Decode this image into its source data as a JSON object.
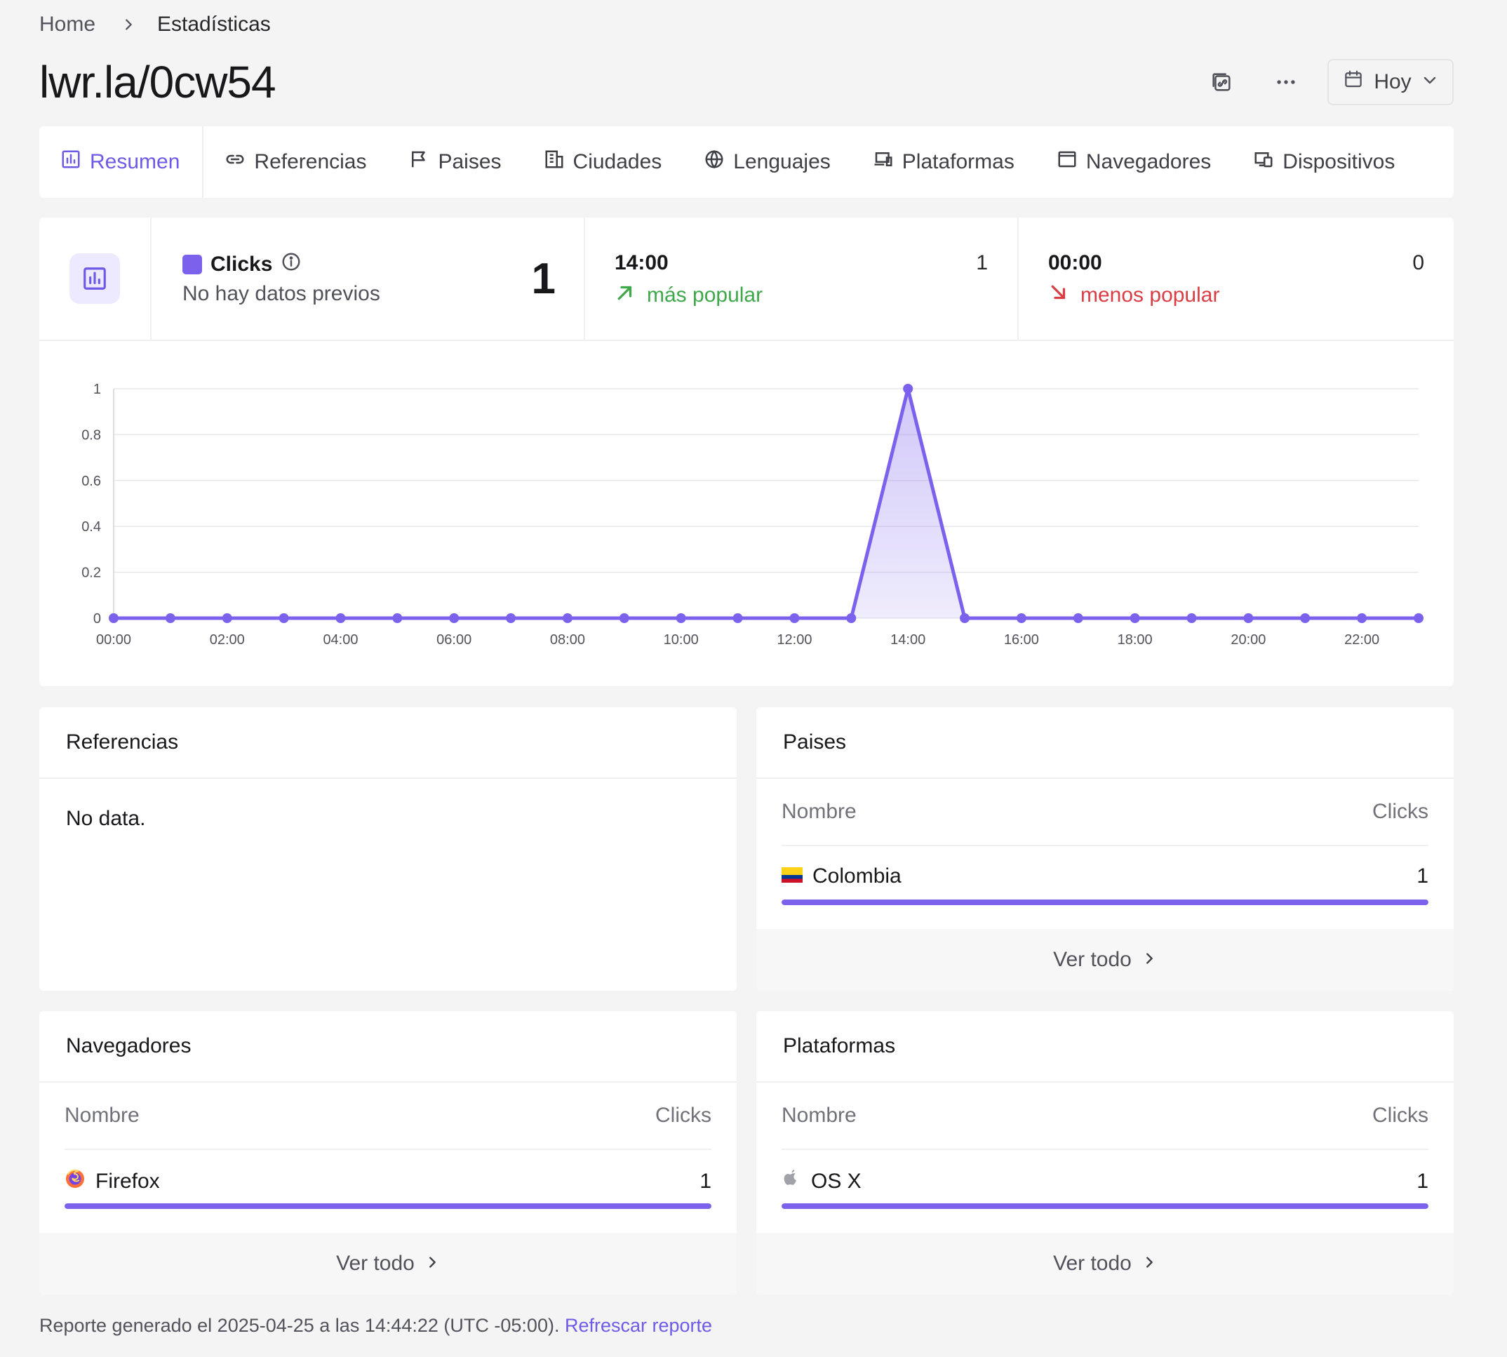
{
  "breadcrumb": {
    "home": "Home",
    "current": "Estadísticas"
  },
  "page_title": "lwr.la/0cw54",
  "top_actions": {
    "icons": [
      "copy-link-icon",
      "more-icon"
    ],
    "date_label": "Hoy"
  },
  "tabs": [
    {
      "label": "Resumen",
      "icon": "bar-chart-icon",
      "active": true
    },
    {
      "label": "Referencias",
      "icon": "link-icon"
    },
    {
      "label": "Paises",
      "icon": "flag-icon"
    },
    {
      "label": "Ciudades",
      "icon": "building-icon"
    },
    {
      "label": "Lenguajes",
      "icon": "globe-icon"
    },
    {
      "label": "Plataformas",
      "icon": "devices-icon"
    },
    {
      "label": "Navegadores",
      "icon": "browser-window-icon"
    },
    {
      "label": "Dispositivos",
      "icon": "device-icon"
    }
  ],
  "stats": {
    "clicks_label": "Clicks",
    "clicks_subtext": "No hay datos previos",
    "clicks_total": "1",
    "peak_hour": "14:00",
    "peak_count": "1",
    "peak_label": "más popular",
    "low_hour": "00:00",
    "low_count": "0",
    "low_label": "menos popular"
  },
  "colors": {
    "accent": "#7b61ec",
    "up": "#3ea84a",
    "down": "#d93e45"
  },
  "chart_data": {
    "type": "area",
    "x": [
      "00:00",
      "01:00",
      "02:00",
      "03:00",
      "04:00",
      "05:00",
      "06:00",
      "07:00",
      "08:00",
      "09:00",
      "10:00",
      "11:00",
      "12:00",
      "13:00",
      "14:00",
      "15:00",
      "16:00",
      "17:00",
      "18:00",
      "19:00",
      "20:00",
      "21:00",
      "22:00",
      "23:00"
    ],
    "series": [
      {
        "values": [
          0,
          0,
          0,
          0,
          0,
          0,
          0,
          0,
          0,
          0,
          0,
          0,
          0,
          0,
          1,
          0,
          0,
          0,
          0,
          0,
          0,
          0,
          0,
          0
        ]
      }
    ],
    "xtick_labels": [
      "00:00",
      "02:00",
      "04:00",
      "06:00",
      "08:00",
      "10:00",
      "12:00",
      "14:00",
      "16:00",
      "18:00",
      "20:00",
      "22:00"
    ],
    "yticks": [
      "0",
      "0.2",
      "0.4",
      "0.6",
      "0.8",
      "1"
    ],
    "ylim": [
      0,
      1
    ],
    "grid": true
  },
  "panels": {
    "referencias": {
      "title": "Referencias",
      "empty": "No data."
    },
    "paises": {
      "title": "Paises",
      "col_name": "Nombre",
      "col_clicks": "Clicks",
      "rows": [
        {
          "name": "Colombia",
          "clicks": "1",
          "share": 1.0,
          "icon": "colombia-flag-icon"
        }
      ],
      "footer": "Ver todo"
    },
    "navegadores": {
      "title": "Navegadores",
      "col_name": "Nombre",
      "col_clicks": "Clicks",
      "rows": [
        {
          "name": "Firefox",
          "clicks": "1",
          "share": 1.0,
          "icon": "firefox-icon"
        }
      ],
      "footer": "Ver todo"
    },
    "plataformas": {
      "title": "Plataformas",
      "col_name": "Nombre",
      "col_clicks": "Clicks",
      "rows": [
        {
          "name": "OS X",
          "clicks": "1",
          "share": 1.0,
          "icon": "apple-icon"
        }
      ],
      "footer": "Ver todo"
    }
  },
  "footer": {
    "text": "Reporte generado el 2025-04-25 a las 14:44:22 (UTC -05:00).",
    "link": "Refrescar reporte"
  }
}
